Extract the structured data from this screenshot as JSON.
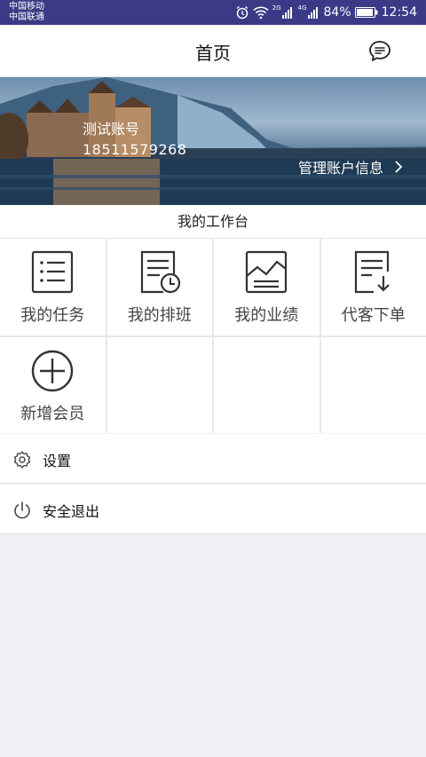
{
  "status_bar": {
    "carrier_1": "中国移动",
    "carrier_2": "中国联通",
    "net_1": "2G",
    "net_2": "4G",
    "battery": "84%",
    "time": "12:54"
  },
  "header": {
    "title": "首页"
  },
  "banner": {
    "account_name": "测试账号",
    "account_phone": "18511579268",
    "manage_link": "管理账户信息"
  },
  "workbench": {
    "title": "我的工作台"
  },
  "grid": {
    "items": [
      {
        "label": "我的任务",
        "icon": "task-list-icon"
      },
      {
        "label": "我的排班",
        "icon": "schedule-icon"
      },
      {
        "label": "我的业绩",
        "icon": "performance-chart-icon"
      },
      {
        "label": "代客下单",
        "icon": "order-download-icon"
      },
      {
        "label": "新增会员",
        "icon": "add-circle-icon"
      }
    ]
  },
  "menu": {
    "settings_label": "设置",
    "logout_label": "安全退出"
  },
  "colors": {
    "status_bar": "#3a3a86",
    "background": "#efeff4",
    "icon_stroke": "#333333"
  }
}
